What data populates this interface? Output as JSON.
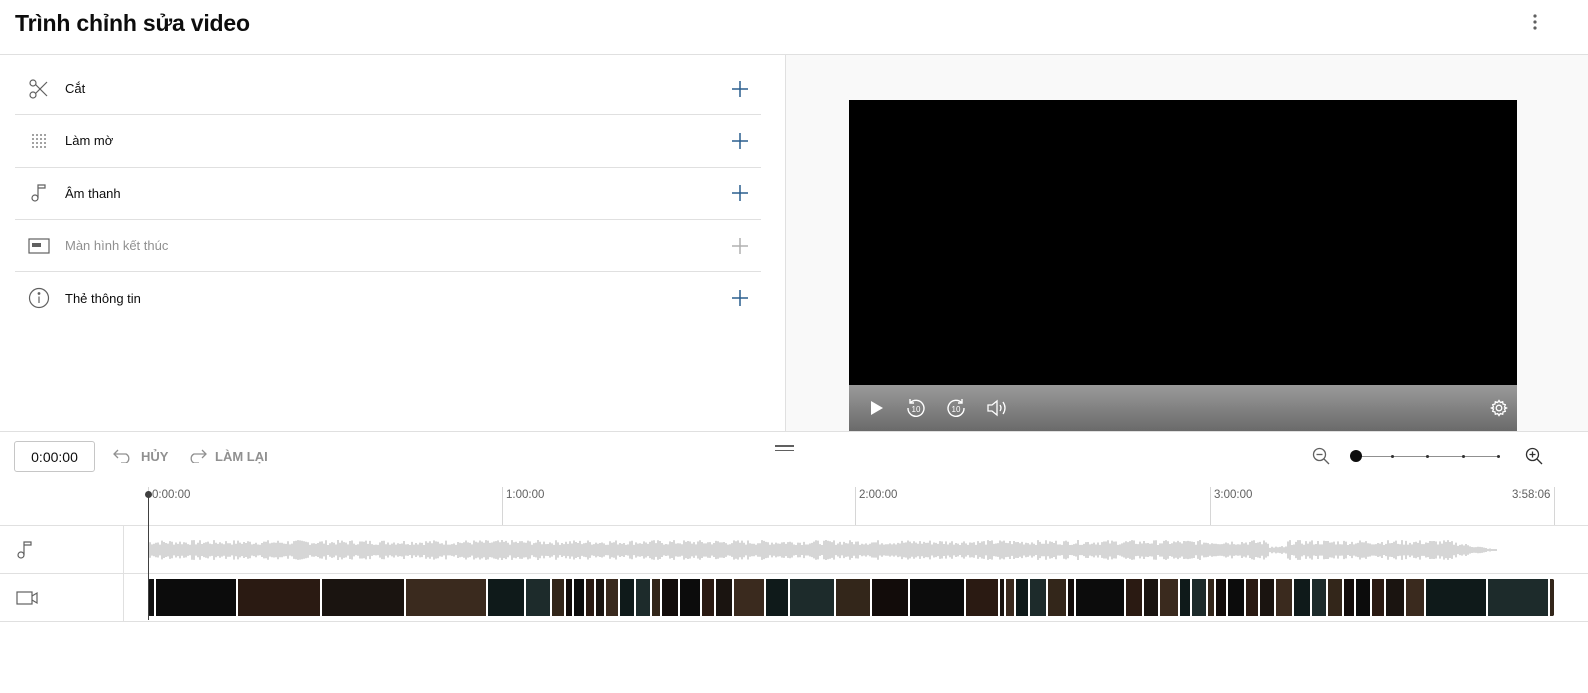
{
  "header": {
    "title": "Trình chỉnh sửa video",
    "more_icon": "more-vert-icon"
  },
  "tools": [
    {
      "label": "Cắt",
      "icon": "scissors-icon",
      "enabled": true
    },
    {
      "label": "Làm mờ",
      "icon": "blur-icon",
      "enabled": true
    },
    {
      "label": "Âm thanh",
      "icon": "music-note-icon",
      "enabled": true
    },
    {
      "label": "Màn hình kết thúc",
      "icon": "end-screen-icon",
      "enabled": false
    },
    {
      "label": "Thẻ thông tin",
      "icon": "info-icon",
      "enabled": true
    }
  ],
  "timeline": {
    "current_time": "0:00:00",
    "undo_label": "HỦY",
    "redo_label": "LÀM LẠI",
    "zoom_level": 0,
    "ruler_labels": [
      "0:00:00",
      "1:00:00",
      "2:00:00",
      "3:00:00",
      "3:58:06"
    ],
    "ruler_fractions": [
      0,
      0.252,
      0.503,
      0.755,
      1.0
    ]
  },
  "colors": {
    "accent": "#065fd4",
    "plus_enabled": "#2a5e8e",
    "plus_disabled": "#b0b0b0",
    "waveform": "#cccccc"
  }
}
